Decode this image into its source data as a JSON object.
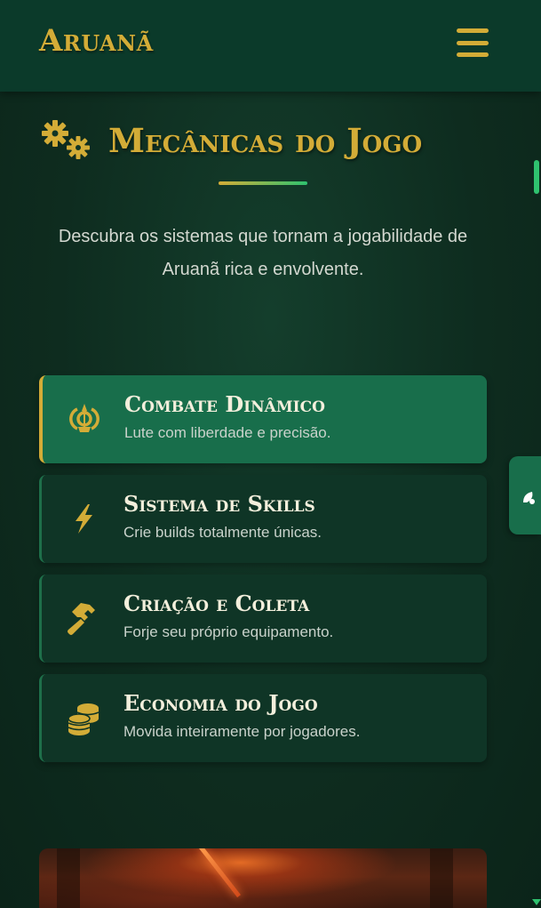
{
  "header": {
    "logo": "Aruanã",
    "menu_icon": "hamburger-menu-icon"
  },
  "section": {
    "title": "Mecânicas do Jogo",
    "title_icon": "gears-icon",
    "description": "Descubra os sistemas que tornam a jogabilidade de Aruanã rica e envolvente."
  },
  "mechanics": [
    {
      "title": "Combate Dinâmico",
      "text": "Lute com liberdade e precisão.",
      "icon": "khanda-icon",
      "active": true
    },
    {
      "title": "Sistema de Skills",
      "text": "Crie builds totalmente únicas.",
      "icon": "bolt-icon",
      "active": false
    },
    {
      "title": "Criação e Coleta",
      "text": "Forje seu próprio equipamento.",
      "icon": "hammer-icon",
      "active": false
    },
    {
      "title": "Economia do Jogo",
      "text": "Movida inteiramente por jogadores.",
      "icon": "coins-icon",
      "active": false
    }
  ],
  "colors": {
    "accent_gold": "#d3ac37",
    "accent_green": "#2fc26f",
    "card_active": "#186e4b",
    "card": "#0f3526",
    "header": "#0b3a2a"
  }
}
